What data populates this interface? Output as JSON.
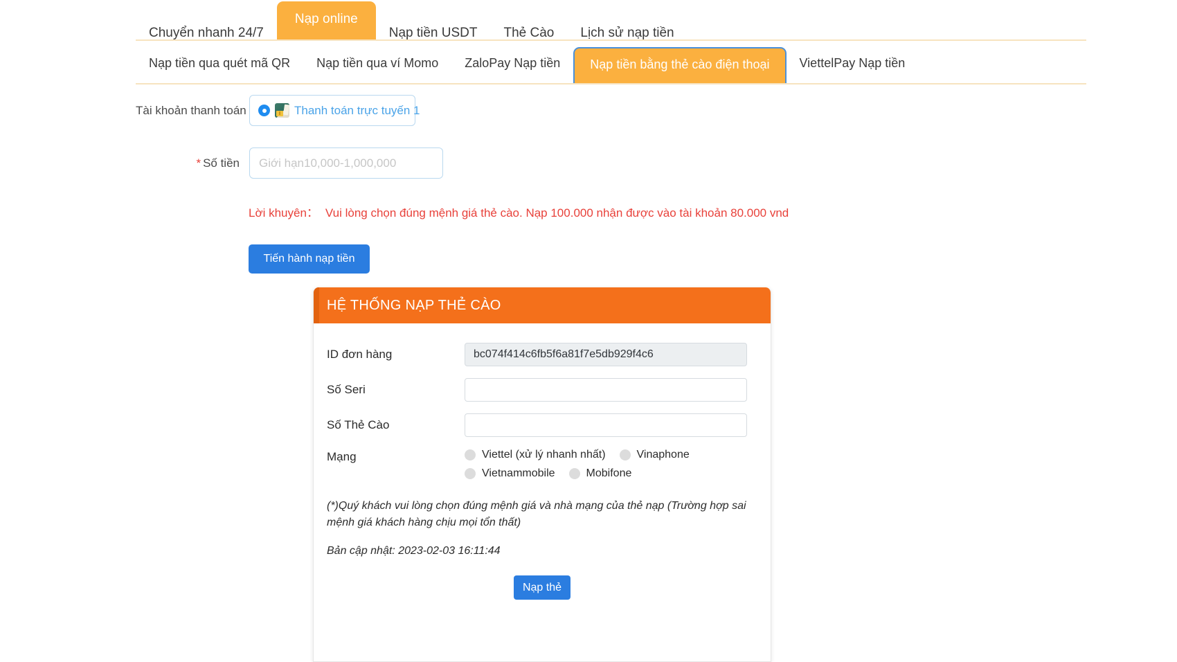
{
  "primary_tabs": [
    {
      "label": "Chuyển nhanh 24/7",
      "active": false
    },
    {
      "label": "Nạp online",
      "active": true
    },
    {
      "label": "Nạp tiền USDT",
      "active": false
    },
    {
      "label": "Thẻ Cào",
      "active": false
    },
    {
      "label": "Lịch sử nạp tiền",
      "active": false
    }
  ],
  "secondary_tabs": [
    {
      "label": "Nạp tiền qua quét mã QR",
      "active": false
    },
    {
      "label": "Nạp tiền qua ví Momo",
      "active": false
    },
    {
      "label": "ZaloPay Nạp tiền",
      "active": false
    },
    {
      "label": "Nạp tiền bằng thẻ cào điện thoại",
      "active": true
    },
    {
      "label": "ViettelPay Nạp tiền",
      "active": false
    }
  ],
  "form": {
    "account_label": "Tài khoản thanh toán",
    "account_option": "Thanh toán trực tuyến 1",
    "amount_label": "Số tiền",
    "amount_required_mark": "*",
    "amount_value": "",
    "amount_placeholder": "Giới hạn10,000-1,000,000",
    "advice_label": "Lời khuyên：",
    "advice_text": "Vui lòng chọn đúng mệnh giá thẻ cào. Nạp 100.000 nhận được vào tài khoản 80.000 vnd",
    "submit_label": "Tiến hành nạp tiền"
  },
  "card_panel": {
    "title": "HỆ THỐNG NẠP THẺ CÀO",
    "order_id_label": "ID đơn hàng",
    "order_id_value": "bc074f414c6fb5f6a81f7e5db929f4c6",
    "serial_label": "Số Seri",
    "serial_value": "",
    "card_number_label": "Số Thẻ Cào",
    "card_number_value": "",
    "network_label": "Mạng",
    "networks": [
      {
        "label": "Viettel (xử lý nhanh nhất)",
        "selected": false
      },
      {
        "label": "Vinaphone",
        "selected": false
      },
      {
        "label": "Vietnammobile",
        "selected": false
      },
      {
        "label": "Mobifone",
        "selected": false
      }
    ],
    "note": "(*)Quý khách vui lòng chọn đúng mệnh giá và nhà mạng của thẻ nạp (Trường hợp sai mệnh giá khách hàng chịu mọi tổn thất)",
    "updated": "Bản cập nhật: 2023-02-03 16:11:44",
    "submit_label": "Nạp thẻ"
  },
  "colors": {
    "tab_active_bg": "#fbb03f",
    "tab_border": "#f7e3bf",
    "tab_focus_border": "#4a90d9",
    "panel_header_bg": "#f4701b",
    "primary_button": "#2b7de0",
    "advice_red": "#e8413a",
    "link_blue": "#4aa3e8"
  }
}
